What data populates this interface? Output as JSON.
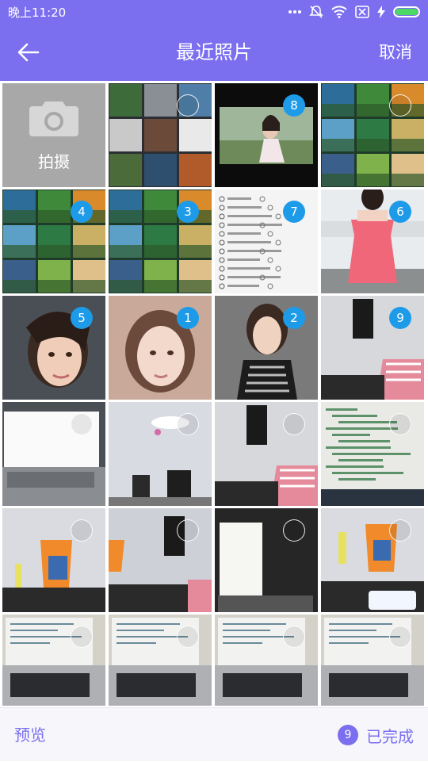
{
  "status_bar": {
    "time": "晚上11:20",
    "icons": [
      "more-dots-icon",
      "notification-mute-icon",
      "wifi-icon",
      "sim-off-icon",
      "charging-icon",
      "battery-icon"
    ],
    "battery_color": "#4cd964"
  },
  "nav": {
    "title": "最近照片",
    "cancel_label": "取消",
    "back_icon": "arrow-left-icon",
    "color": "#7b6ff0"
  },
  "camera": {
    "label": "拍摄",
    "icon": "camera-icon"
  },
  "photos": [
    {
      "mark": "",
      "scene": "screenshot-grid"
    },
    {
      "mark": "8",
      "scene": "woman-outdoor"
    },
    {
      "mark": "",
      "scene": "landscape-grid"
    },
    {
      "mark": "4",
      "scene": "landscape-grid"
    },
    {
      "mark": "3",
      "scene": "landscape-grid"
    },
    {
      "mark": "7",
      "scene": "settings-screenshot"
    },
    {
      "mark": "6",
      "scene": "pink-dress"
    },
    {
      "mark": "5",
      "scene": "woman-portrait"
    },
    {
      "mark": "1",
      "scene": "woman-portrait-pale"
    },
    {
      "mark": "2",
      "scene": "woman-striped"
    },
    {
      "mark": "9",
      "scene": "room-tv"
    },
    {
      "mark": "",
      "scene": "laptop"
    },
    {
      "mark": "",
      "scene": "ceiling-room"
    },
    {
      "mark": "",
      "scene": "room-tv"
    },
    {
      "mark": "",
      "scene": "code-screen"
    },
    {
      "mark": "",
      "scene": "orange-bag"
    },
    {
      "mark": "",
      "scene": "room-tv-bag"
    },
    {
      "mark": "",
      "scene": "laptop-dark"
    },
    {
      "mark": "",
      "scene": "orange-bag-phone"
    },
    {
      "mark": "",
      "scene": "laptop-desk"
    },
    {
      "mark": "",
      "scene": "laptop-desk"
    },
    {
      "mark": "",
      "scene": "laptop-desk"
    },
    {
      "mark": "",
      "scene": "laptop-desk"
    }
  ],
  "bottom_bar": {
    "preview_label": "预览",
    "selected_count": "9",
    "done_label": "已完成"
  },
  "colors": {
    "accent": "#7b6ff0",
    "selection_badge": "#1e9be8"
  }
}
